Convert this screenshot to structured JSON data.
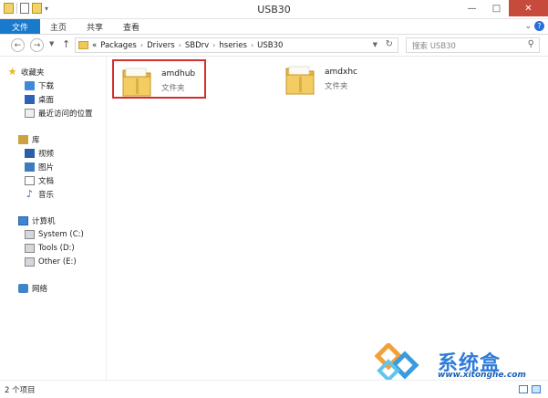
{
  "window": {
    "title": "USB30",
    "minimize": "—",
    "maximize": "□",
    "close": "✕"
  },
  "quick_access": {
    "dropdown_glyph": "▾"
  },
  "ribbon": {
    "tabs": [
      "文件",
      "主页",
      "共享",
      "查看"
    ],
    "expand_glyph": "⌄",
    "help_glyph": "?"
  },
  "nav": {
    "back": "←",
    "forward": "→",
    "recent_dropdown": "▼",
    "up": "↑"
  },
  "address": {
    "overflow": "«",
    "crumbs": [
      "Packages",
      "Drivers",
      "SBDrv",
      "hseries",
      "USB30"
    ],
    "separator": "›",
    "dropdown": "▼",
    "refresh": "↻"
  },
  "search": {
    "placeholder": "搜索 USB30",
    "icon": "⚲"
  },
  "sidebar": {
    "favorites": {
      "label": "收藏夹",
      "items": [
        "下载",
        "桌面",
        "最近访问的位置"
      ]
    },
    "libraries": {
      "label": "库",
      "items": [
        "视频",
        "图片",
        "文档",
        "音乐"
      ]
    },
    "computer": {
      "label": "计算机",
      "items": [
        "System (C:)",
        "Tools (D:)",
        "Other (E:)"
      ]
    },
    "network": {
      "label": "网络"
    }
  },
  "files": [
    {
      "name": "amdhub",
      "type": "文件夹",
      "selected": true,
      "icon": "folder-icon"
    },
    {
      "name": "amdxhc",
      "type": "文件夹",
      "selected": false,
      "icon": "folder-icon"
    }
  ],
  "status": {
    "count": "2 个项目"
  },
  "watermark": {
    "brand": "系统盒",
    "url": "www.xitonghe.com"
  },
  "colors": {
    "file_tab": "#1979ca",
    "close_button": "#c74b3d",
    "selection_border": "#d52c2c",
    "folder": "#f1c75a",
    "watermark_blue": "#2e7bd8"
  }
}
